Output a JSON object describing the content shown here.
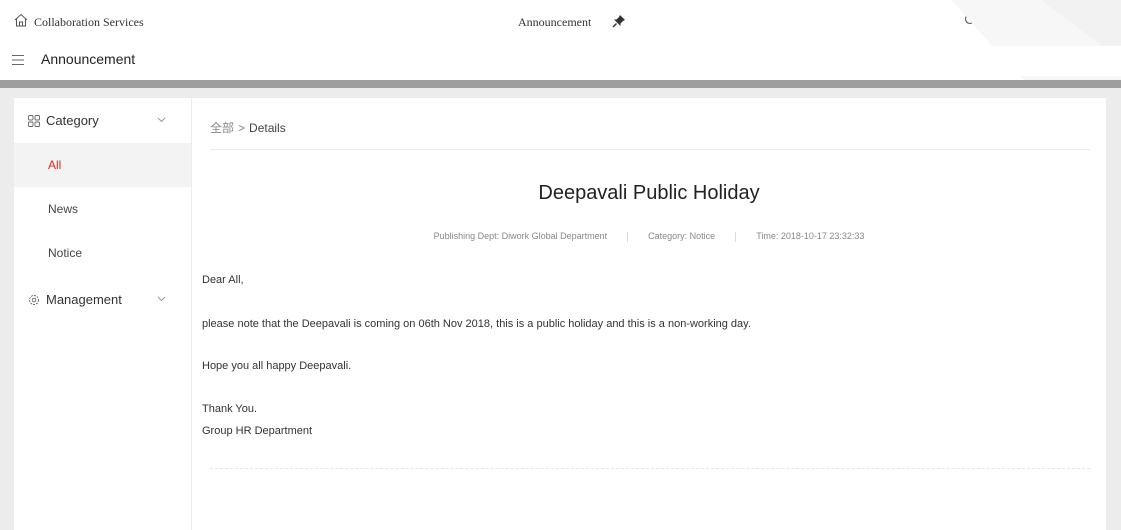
{
  "topbar": {
    "app_name": "Collaboration Services",
    "center_title": "Announcement",
    "icons": [
      "home-icon",
      "pin-icon",
      "search-icon",
      "network-icon",
      "apps-icon",
      "bell-icon"
    ],
    "notification_dot_color": "#e03030"
  },
  "subbar": {
    "title": "Announcement"
  },
  "sidebar": {
    "category_label": "Category",
    "items": [
      {
        "label": "All",
        "active": true
      },
      {
        "label": "News",
        "active": false
      },
      {
        "label": "Notice",
        "active": false
      }
    ],
    "management_label": "Management"
  },
  "main": {
    "breadcrumb": {
      "root": "全部",
      "separator": ">",
      "current": "Details"
    },
    "title": "Deepavali Public Holiday",
    "meta": {
      "dept": "Publishing Dept: Diwork Global Department",
      "category": "Category: Notice",
      "time": "Time: 2018-10-17 23:32:33"
    },
    "body": {
      "greeting": "Dear All,",
      "line1": "please note that the Deepavali is coming on 06th Nov 2018, this is a public holiday and this is a non-working day.",
      "line2": "Hope you all happy Deepavali.",
      "closing": "Thank You.",
      "signature": "Group HR Department"
    }
  },
  "colors": {
    "accent": "#e0261c",
    "band": "#9e9e9e",
    "background": "#ececec"
  }
}
